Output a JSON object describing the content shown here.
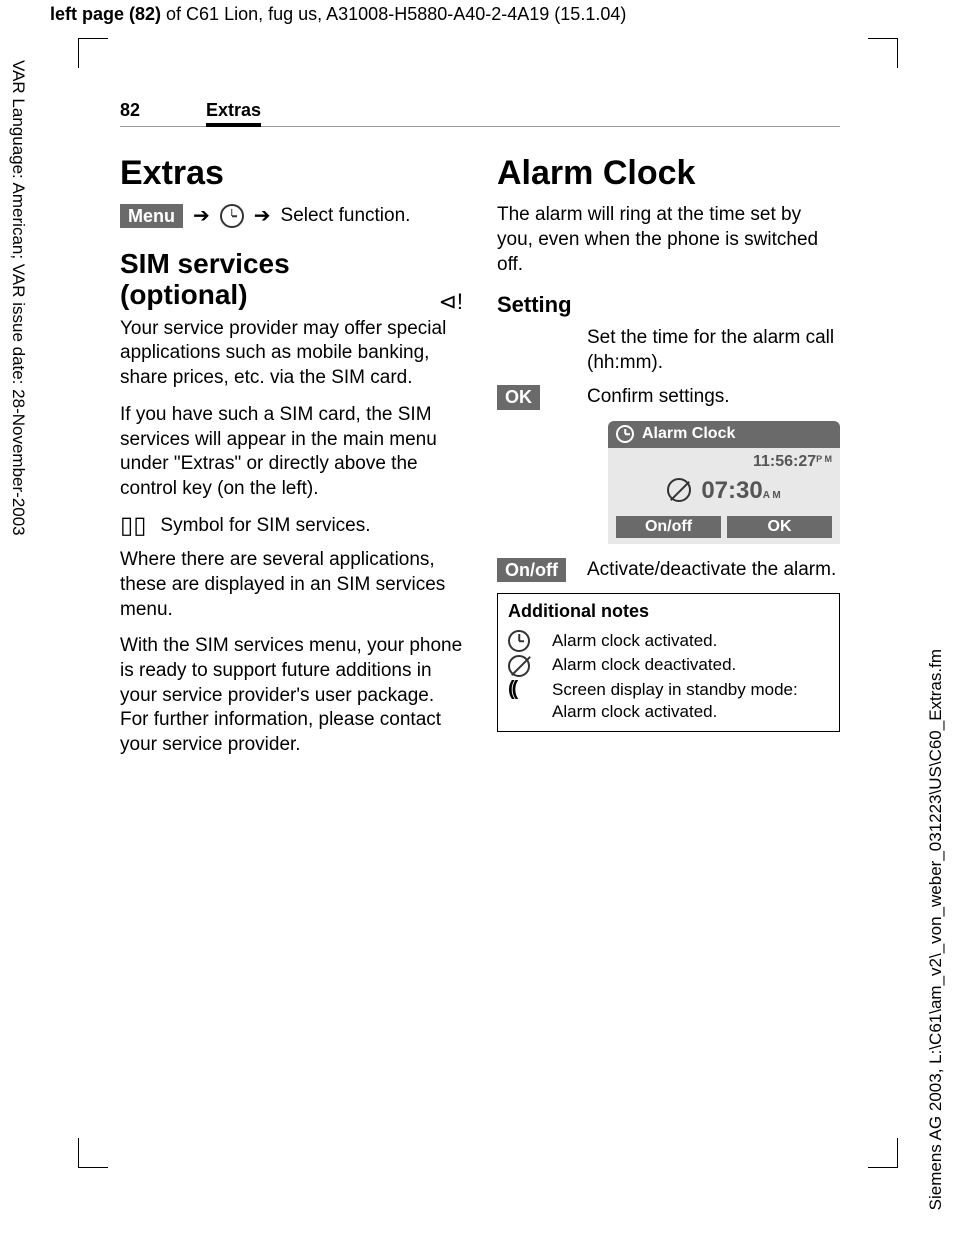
{
  "header": {
    "left_bold": "left page (82)",
    "rest": " of C61 Lion, fug us, A31008-H5880-A40-2-4A19 (15.1.04)"
  },
  "side_left": "VAR Language: American; VAR issue date: 28-November-2003",
  "side_right": "Siemens AG 2003, L:\\C61\\am_v2\\_von_weber_031223\\US\\C60_Extras.fm",
  "page": {
    "number": "82",
    "section_label": "Extras"
  },
  "left_col": {
    "chapter_title": "Extras",
    "menu_button": "Menu",
    "menu_text": "Select function.",
    "sim_title_1": "SIM services",
    "sim_title_2": "(optional)",
    "provider_glyph": "⊲!",
    "p1": "Your service provider may offer special applications such as mobile banking, share prices, etc. via the SIM card.",
    "p2": "If you have such a SIM card, the SIM services will appear in the main menu under \"Extras\" or directly above the control key (on the left).",
    "sim_symbol_label": "Symbol for SIM services.",
    "p3": "Where there are several applications, these are displayed in an SIM services menu.",
    "p4": "With the SIM services menu, your phone is ready to support future additions in your service provider's user package. For further information, please contact your service provider."
  },
  "right_col": {
    "chapter_title": "Alarm Clock",
    "intro": "The alarm will ring at the time set by you, even when the phone is switched off.",
    "setting_heading": "Setting",
    "set_time_text": "Set the time for the alarm call (hh:mm).",
    "ok_key": "OK",
    "ok_text": "Confirm settings.",
    "screen": {
      "title": "Alarm Clock",
      "clock_time": "11:56:27",
      "clock_ampm": "P\nM",
      "alarm_time": "07:30",
      "alarm_ampm": "A\nM",
      "soft_left": "On/off",
      "soft_right": "OK"
    },
    "onoff_key": "On/off",
    "onoff_text": "Activate/deactivate the alarm.",
    "notes": {
      "heading": "Additional notes",
      "r1": "Alarm clock activated.",
      "r2": "Alarm clock deactivated.",
      "r3": "Screen display in standby mode: Alarm clock activated."
    }
  }
}
